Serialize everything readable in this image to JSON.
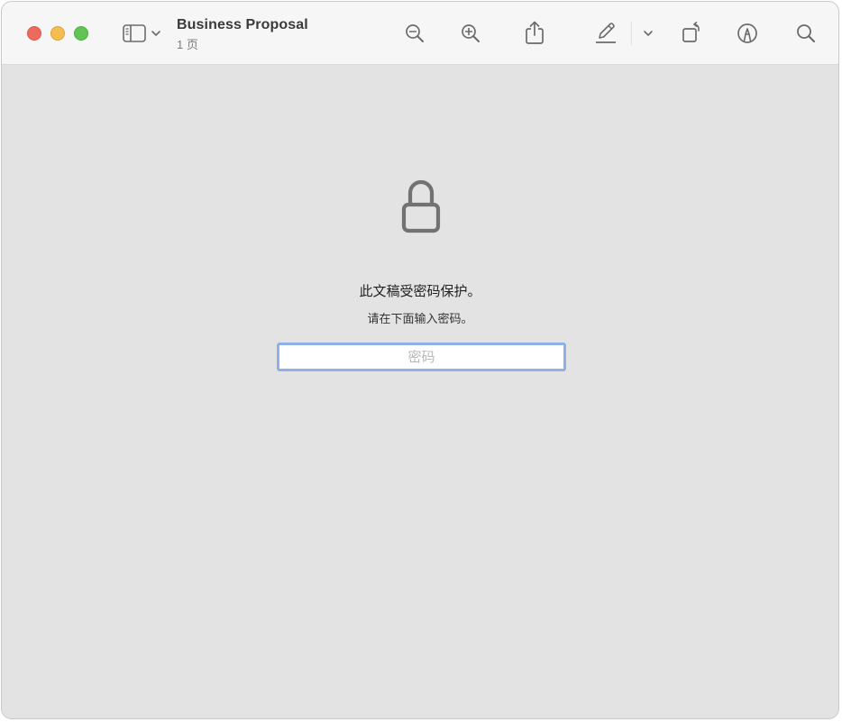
{
  "window": {
    "title": "Business Proposal",
    "subtitle": "1 页"
  },
  "toolbar": {
    "sidebar_toggle": "sidebar-icon",
    "zoom_out": "zoom-out-icon",
    "zoom_in": "zoom-in-icon",
    "share": "share-icon",
    "highlight": "highlighter-pen-icon",
    "highlight_menu": "chevron-down-icon",
    "rotate": "rotate-icon",
    "markup": "markup-icon",
    "search": "search-icon"
  },
  "locked": {
    "icon": "lock-icon",
    "message": "此文稿受密码保护。",
    "instruction": "请在下面输入密码。",
    "password_placeholder": "密码",
    "password_value": ""
  },
  "colors": {
    "close": "#ee6a5f",
    "minimize": "#f5bd4f",
    "maximize": "#61c554",
    "focus_ring": "#8fb0e6",
    "content_bg": "#e3e3e3",
    "toolbar_bg": "#f6f6f6"
  }
}
